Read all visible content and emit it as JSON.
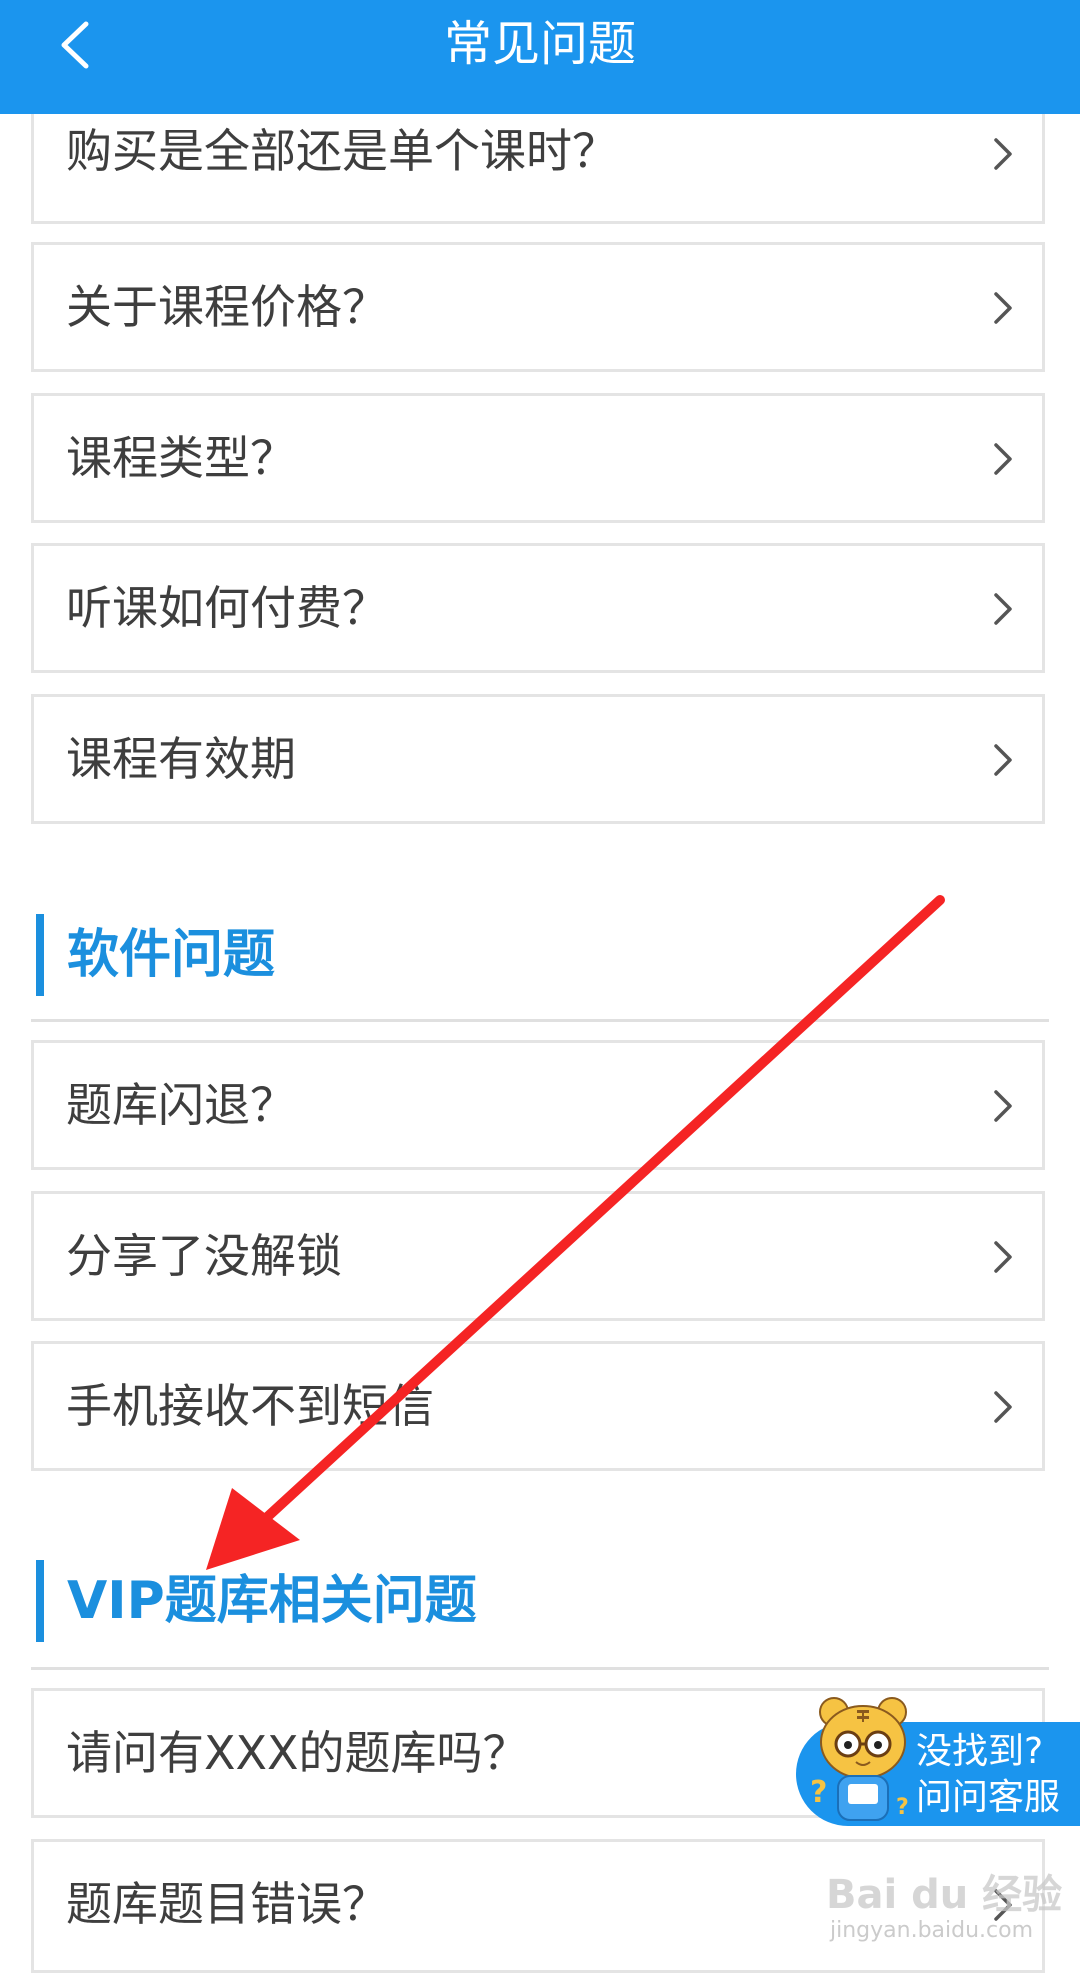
{
  "header": {
    "title": "常见问题",
    "back_icon": "chevron-left-icon"
  },
  "items_top": [
    {
      "label": "购买是全部还是单个课时？"
    },
    {
      "label": "关于课程价格？"
    },
    {
      "label": "课程类型？"
    },
    {
      "label": "听课如何付费？"
    },
    {
      "label": "课程有效期"
    }
  ],
  "sections": [
    {
      "title": "软件问题",
      "items": [
        {
          "label": "题库闪退？"
        },
        {
          "label": "分享了没解锁"
        },
        {
          "label": "手机接收不到短信"
        }
      ]
    },
    {
      "title": "VIP题库相关问题",
      "items": [
        {
          "label": "请问有XXX的题库吗？"
        },
        {
          "label": "题库题目错误？"
        }
      ]
    }
  ],
  "service": {
    "line1": "没找到?",
    "line2": "问问客服"
  },
  "watermark": {
    "text": "Bai du 经验",
    "url": "jingyan.baidu.com"
  },
  "colors": {
    "header_bg": "#1b95ee",
    "section_title": "#1b8fde",
    "annotation_arrow": "#f52424"
  }
}
